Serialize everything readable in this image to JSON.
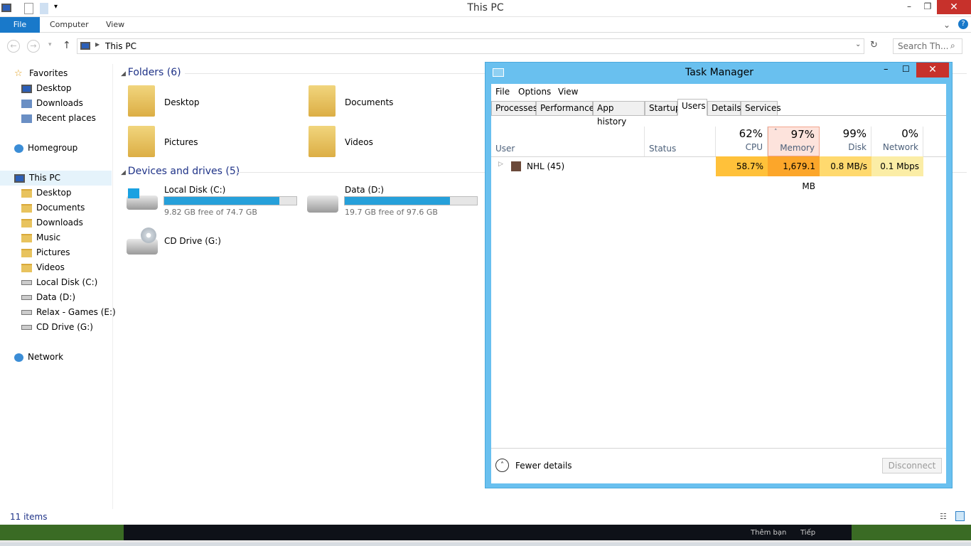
{
  "window": {
    "title": "This PC"
  },
  "ribbon": {
    "tabs": [
      "File",
      "Computer",
      "View"
    ]
  },
  "address": {
    "path": "This PC",
    "search_placeholder": "Search Th..."
  },
  "nav": {
    "items": [
      {
        "label": "Favorites",
        "icon": "star-icon",
        "indent": 0
      },
      {
        "label": "Desktop",
        "icon": "desktop-icon",
        "indent": 1
      },
      {
        "label": "Downloads",
        "icon": "downloads-icon",
        "indent": 1
      },
      {
        "label": "Recent places",
        "icon": "recent-places-icon",
        "indent": 1
      },
      {
        "label": "Homegroup",
        "icon": "homegroup-icon",
        "indent": 0,
        "gap": true
      },
      {
        "label": "This PC",
        "icon": "pc-icon",
        "indent": 0,
        "gap": true,
        "selected": true
      },
      {
        "label": "Desktop",
        "icon": "folder-icon",
        "indent": 1
      },
      {
        "label": "Documents",
        "icon": "folder-icon",
        "indent": 1
      },
      {
        "label": "Downloads",
        "icon": "folder-icon",
        "indent": 1
      },
      {
        "label": "Music",
        "icon": "folder-icon",
        "indent": 1
      },
      {
        "label": "Pictures",
        "icon": "folder-icon",
        "indent": 1
      },
      {
        "label": "Videos",
        "icon": "folder-icon",
        "indent": 1
      },
      {
        "label": "Local Disk (C:)",
        "icon": "drive-icon",
        "indent": 1
      },
      {
        "label": "Data (D:)",
        "icon": "drive-icon",
        "indent": 1
      },
      {
        "label": "Relax - Games (E:)",
        "icon": "drive-icon",
        "indent": 1
      },
      {
        "label": "CD Drive (G:)",
        "icon": "cd-drive-icon",
        "indent": 1
      },
      {
        "label": "Network",
        "icon": "network-icon",
        "indent": 0,
        "gap": true
      }
    ]
  },
  "content": {
    "folders_header": "Folders (6)",
    "folders": [
      "Desktop",
      "Documents",
      "Pictures",
      "Videos"
    ],
    "devices_header": "Devices and drives (5)",
    "drives": [
      {
        "name": "Local Disk (C:)",
        "free": "9.82 GB free of 74.7 GB",
        "used_fraction": 0.869
      },
      {
        "name": "Data (D:)",
        "free": "19.7 GB free of 97.6 GB",
        "used_fraction": 0.798
      },
      {
        "name": "CD Drive (G:)"
      }
    ]
  },
  "status": {
    "items": "11 items"
  },
  "taskbar_strip": {
    "add_friend": "Thêm bạn",
    "next": "Tiếp"
  },
  "task_manager": {
    "title": "Task Manager",
    "menu": [
      "File",
      "Options",
      "View"
    ],
    "tabs": [
      "Processes",
      "Performance",
      "App history",
      "Startup",
      "Users",
      "Details",
      "Services"
    ],
    "active_tab": "Users",
    "columns": {
      "user": "User",
      "status": "Status",
      "cpu": {
        "pct": "62%",
        "label": "CPU"
      },
      "memory": {
        "pct": "97%",
        "label": "Memory"
      },
      "disk": {
        "pct": "99%",
        "label": "Disk"
      },
      "network": {
        "pct": "0%",
        "label": "Network"
      }
    },
    "rows": [
      {
        "user": "NHL (45)",
        "cpu": "58.7%",
        "memory": "1,679.1 MB",
        "disk": "0.8 MB/s",
        "network": "0.1 Mbps"
      }
    ],
    "fewer_details": "Fewer details",
    "disconnect": "Disconnect",
    "heat_colors": {
      "cpu": "#ffc13a",
      "memory": "#fca62a",
      "disk": "#ffd96e",
      "network": "#fbeda6"
    }
  }
}
